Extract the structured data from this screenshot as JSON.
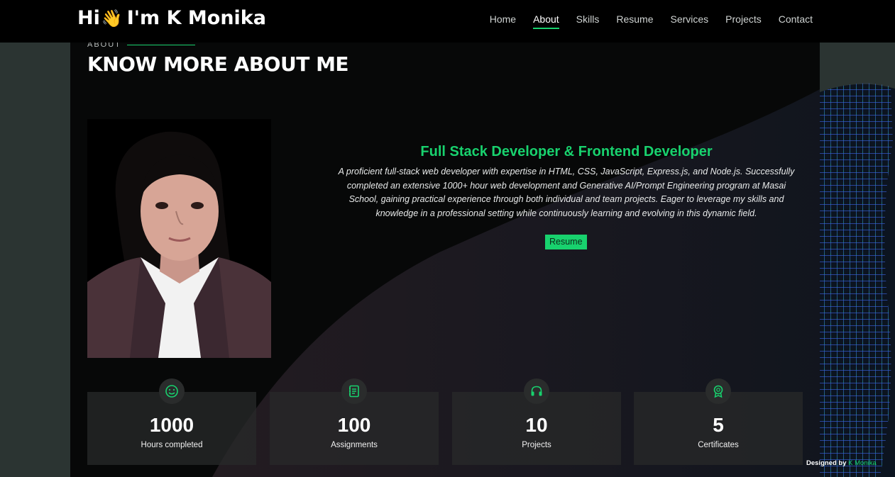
{
  "header": {
    "logo_hi": "Hi",
    "logo_hand": "👋",
    "logo_name": "I'm K Monika",
    "nav": [
      "Home",
      "About",
      "Skills",
      "Resume",
      "Services",
      "Projects",
      "Contact"
    ],
    "active_nav": "About"
  },
  "about": {
    "kicker": "ABOUT",
    "title": "KNOW MORE ABOUT ME",
    "role": "Full Stack Developer & Frontend Developer",
    "bio": "A proficient full-stack web developer with expertise in HTML, CSS, JavaScript, Express.js, and Node.js. Successfully completed an extensive 1000+ hour web development and Generative AI/Prompt Engineering program at Masai School, gaining practical experience through both individual and team projects. Eager to leverage my skills and knowledge in a professional setting while continuously learning and evolving in this dynamic field.",
    "resume_label": "Resume"
  },
  "stats": [
    {
      "icon": "smiley-icon",
      "value": "1000",
      "label": "Hours completed"
    },
    {
      "icon": "journal-icon",
      "value": "100",
      "label": "Assignments"
    },
    {
      "icon": "headset-icon",
      "value": "10",
      "label": "Projects"
    },
    {
      "icon": "award-icon",
      "value": "5",
      "label": "Certificates"
    }
  ],
  "footer": {
    "designed_by": "Designed by",
    "designer": "K Monika"
  },
  "colors": {
    "accent": "#18d26e",
    "header_bg": "#000000",
    "card_bg": "#040505"
  }
}
